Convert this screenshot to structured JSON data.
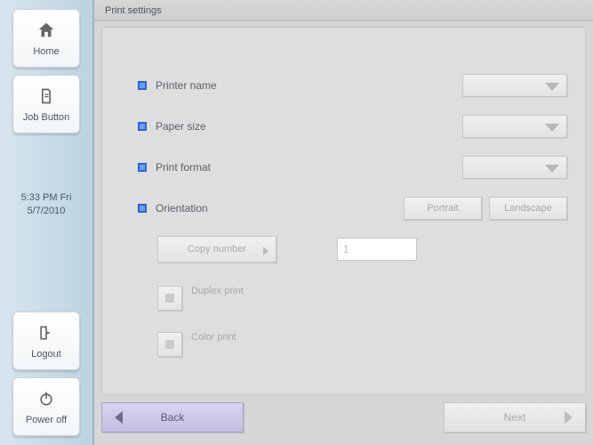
{
  "sidebar": {
    "home": "Home",
    "job_button": "Job Button",
    "logout": "Logout",
    "power_off": "Power off",
    "time_line1": "5:33 PM  Fri",
    "time_line2": "5/7/2010"
  },
  "title": "Print settings",
  "form": {
    "printer_name": {
      "label": "Printer name",
      "value": ""
    },
    "paper_size": {
      "label": "Paper size",
      "value": ""
    },
    "print_format": {
      "label": "Print format",
      "value": ""
    },
    "orientation": {
      "label": "Orientation",
      "portrait": "Portrait",
      "landscape": "Landscape"
    },
    "copy_number": {
      "button": "Copy number",
      "value": "1"
    },
    "duplex": {
      "label": "Duplex print",
      "checked": false
    },
    "color": {
      "label": "Color print",
      "checked": false
    }
  },
  "footer": {
    "back": "Back",
    "next": "Next"
  }
}
